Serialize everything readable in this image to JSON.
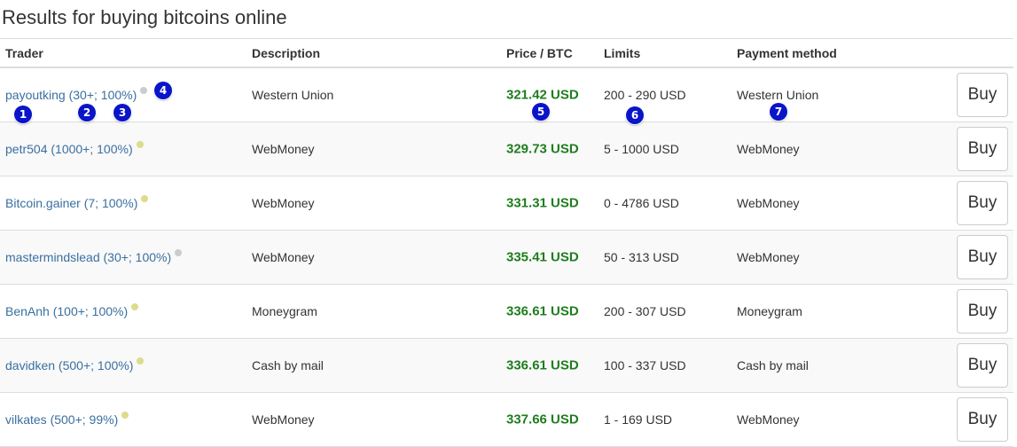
{
  "page_title": "Results for buying bitcoins online",
  "columns": {
    "trader": "Trader",
    "description": "Description",
    "price": "Price / BTC",
    "limits": "Limits",
    "payment": "Payment method"
  },
  "rows": [
    {
      "trader": "payoutking (30+; 100%)",
      "dot_color": "#cccccc",
      "description": "Western Union",
      "price": "321.42 USD",
      "limits": "200 - 290 USD",
      "payment": "Western Union",
      "buy_label": "Buy"
    },
    {
      "trader": "petr504 (1000+; 100%)",
      "dot_color": "#dcdc8c",
      "description": "WebMoney",
      "price": "329.73 USD",
      "limits": "5 - 1000 USD",
      "payment": "WebMoney",
      "buy_label": "Buy"
    },
    {
      "trader": "Bitcoin.gainer (7; 100%)",
      "dot_color": "#dcdc8c",
      "description": "WebMoney",
      "price": "331.31 USD",
      "limits": "0 - 4786 USD",
      "payment": "WebMoney",
      "buy_label": "Buy"
    },
    {
      "trader": "mastermindslead (30+; 100%)",
      "dot_color": "#cccccc",
      "description": "WebMoney",
      "price": "335.41 USD",
      "limits": "50 - 313 USD",
      "payment": "WebMoney",
      "buy_label": "Buy"
    },
    {
      "trader": "BenAnh (100+; 100%)",
      "dot_color": "#dcdc8c",
      "description": "Moneygram",
      "price": "336.61 USD",
      "limits": "200 - 307 USD",
      "payment": "Moneygram",
      "buy_label": "Buy"
    },
    {
      "trader": "davidken (500+; 100%)",
      "dot_color": "#dcdc8c",
      "description": "Cash by mail",
      "price": "336.61 USD",
      "limits": "100 - 337 USD",
      "payment": "Cash by mail",
      "buy_label": "Buy"
    },
    {
      "trader": "vilkates (500+; 99%)",
      "dot_color": "#dcdc8c",
      "description": "WebMoney",
      "price": "337.66 USD",
      "limits": "1 - 169 USD",
      "payment": "WebMoney",
      "buy_label": "Buy"
    }
  ],
  "markers": [
    "1",
    "2",
    "3",
    "4",
    "5",
    "6",
    "7"
  ],
  "colors": {
    "price": "#1e7d1e",
    "link": "#3a6fa0",
    "marker": "#0a14c8",
    "row_stripe": "#f9f9f9"
  }
}
